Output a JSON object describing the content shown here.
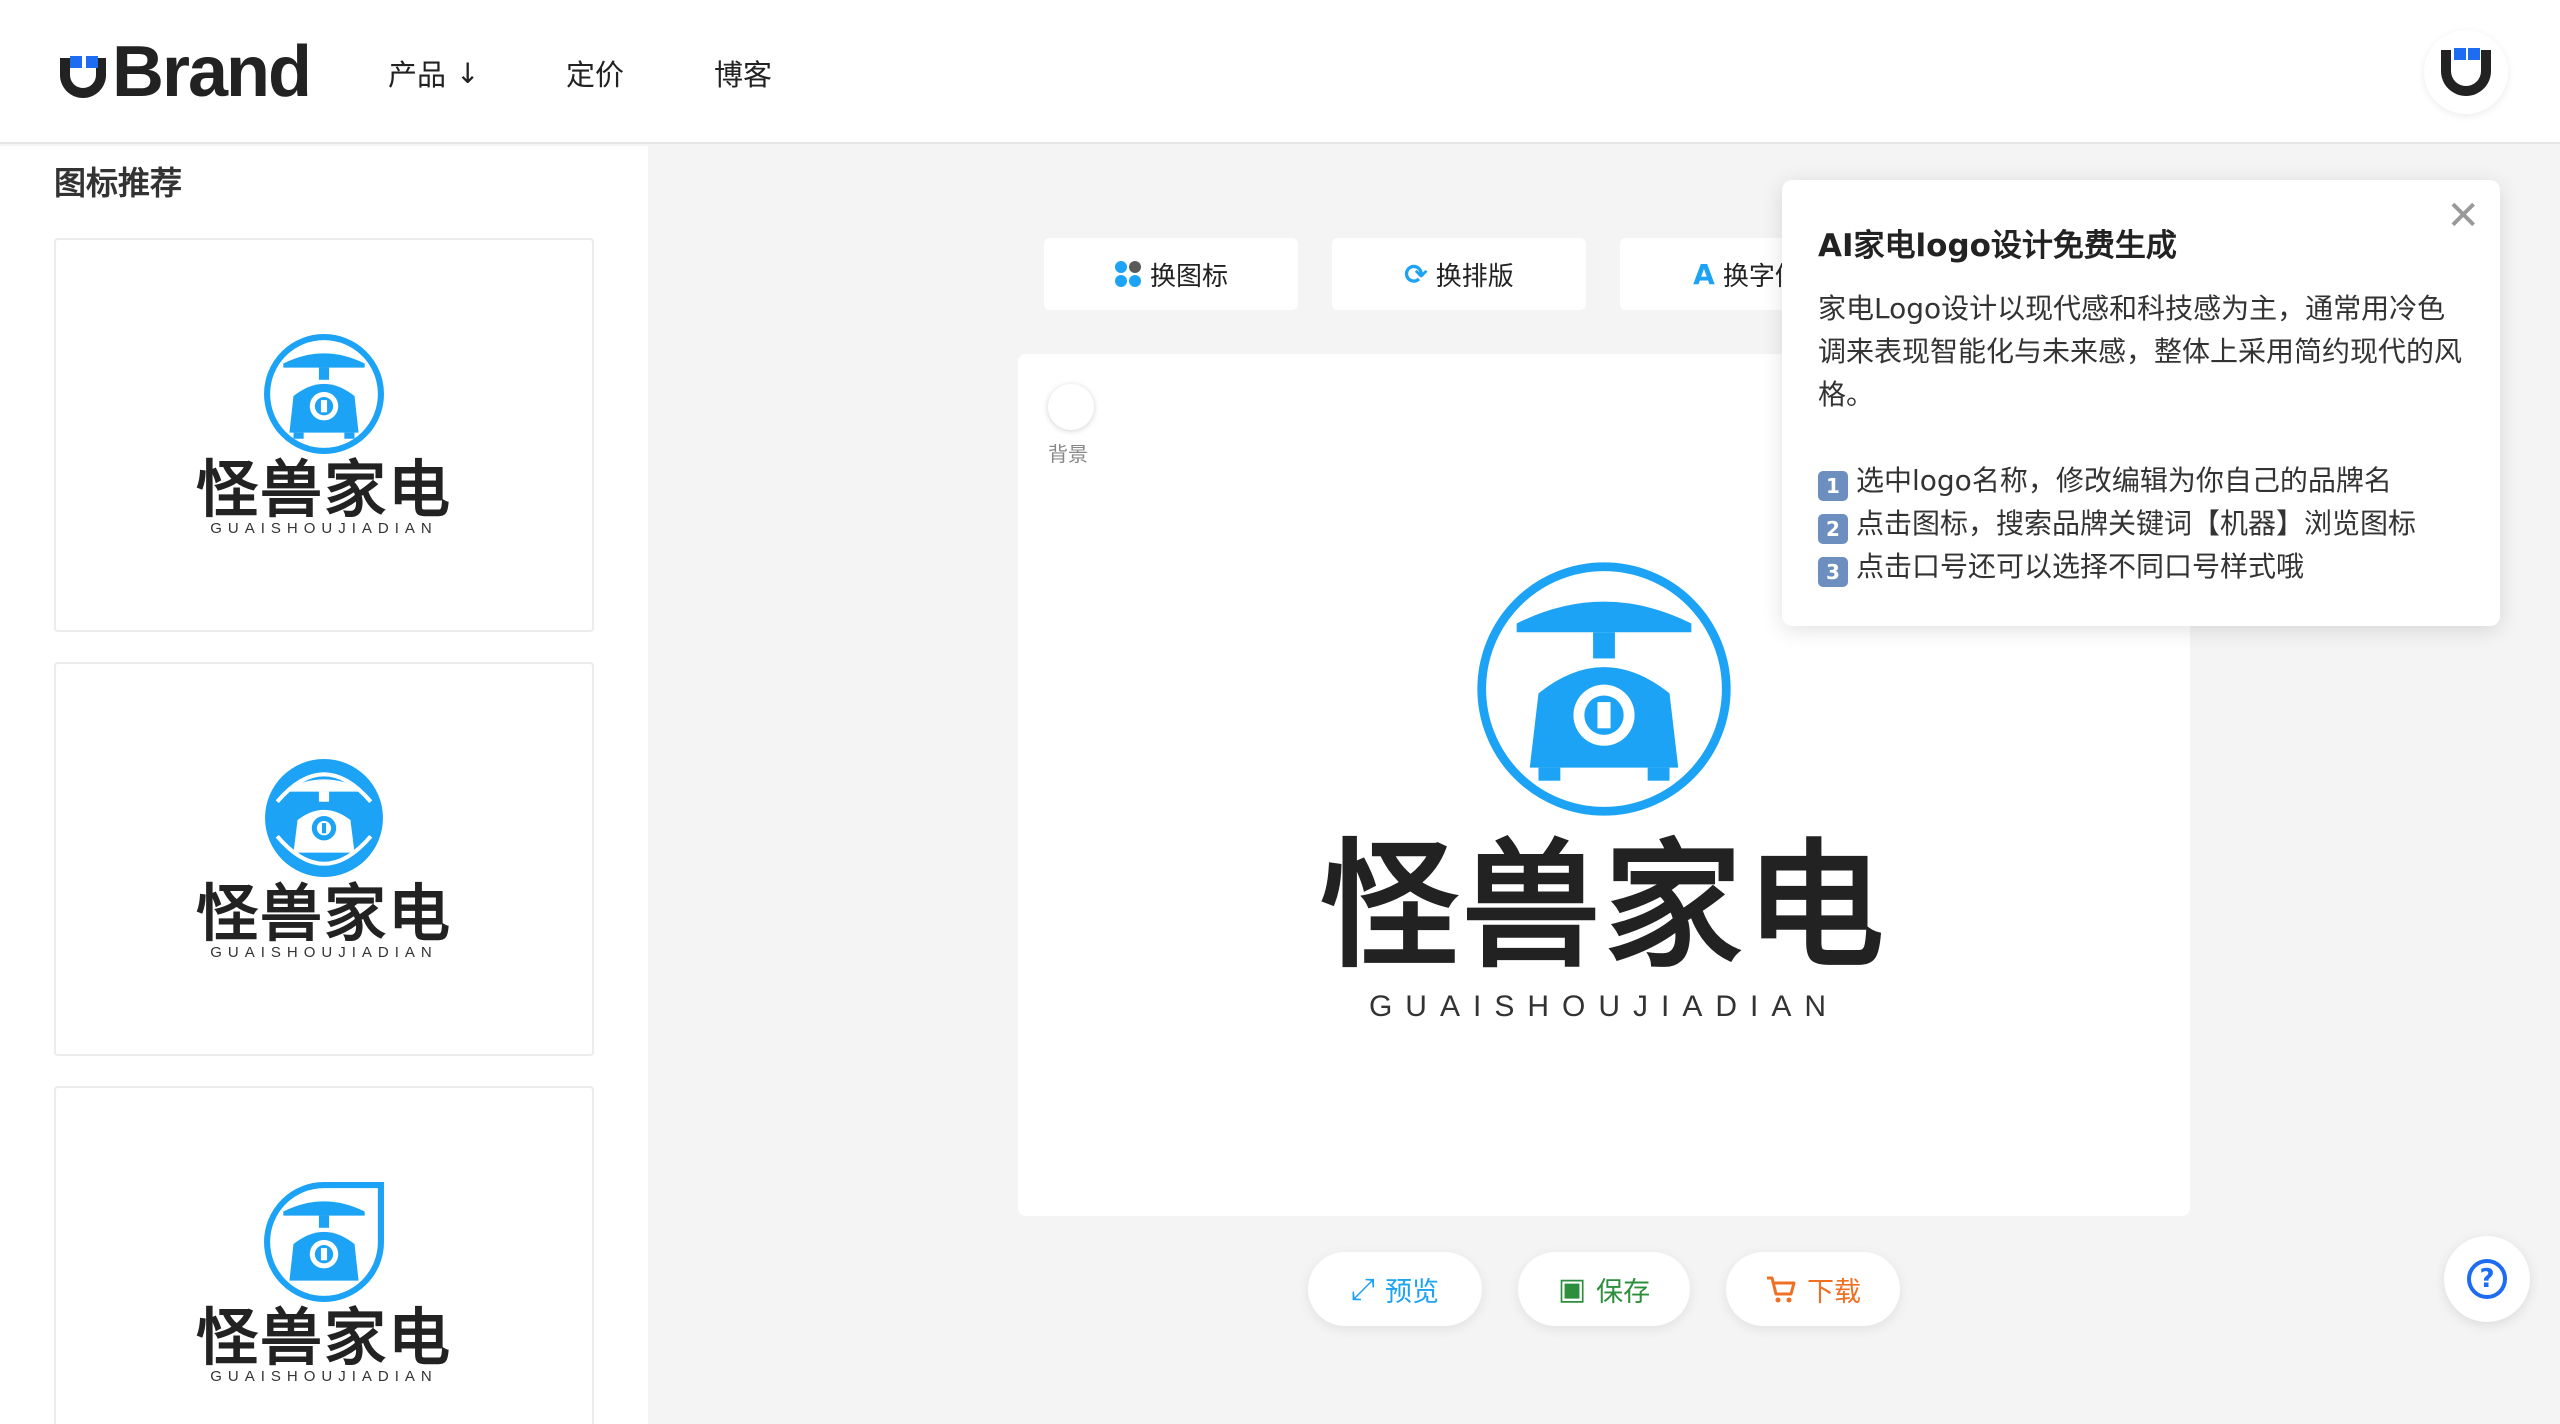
{
  "header": {
    "brand": "Brand",
    "nav": {
      "products": "产品",
      "products_arrow": "↓",
      "pricing": "定价",
      "blog": "博客"
    }
  },
  "sidebar": {
    "title": "图标推荐",
    "cards": [
      {
        "name": "怪兽家电",
        "pinyin": "GUAISHOUJIADIAN"
      },
      {
        "name": "怪兽家电",
        "pinyin": "GUAISHOUJIADIAN"
      },
      {
        "name": "怪兽家电",
        "pinyin": "GUAISHOUJIADIAN"
      }
    ]
  },
  "toolbar": {
    "change_icon": "换图标",
    "change_layout": "换排版",
    "change_font": "换字体"
  },
  "canvas": {
    "bg_label": "背景",
    "logo_name": "怪兽家电",
    "logo_pinyin": "GUAISHOUJIADIAN"
  },
  "actions": {
    "preview": "预览",
    "save": "保存",
    "download": "下载"
  },
  "tip": {
    "title": "AI家电logo设计免费生成",
    "desc": "家电Logo设计以现代感和科技感为主，通常用冷色调来表现智能化与未来感，整体上采用简约现代的风格。",
    "steps": [
      {
        "num": "1",
        "text": "选中logo名称，修改编辑为你自己的品牌名"
      },
      {
        "num": "2",
        "text": "点击图标，搜索品牌关键词【机器】浏览图标"
      },
      {
        "num": "3",
        "text": "点击口号还可以选择不同口号样式哦"
      }
    ]
  },
  "colors": {
    "accent": "#1ca3f5",
    "brand_blue": "#1e6cf2",
    "save_green": "#2d8f3d",
    "download_orange": "#f07023"
  }
}
